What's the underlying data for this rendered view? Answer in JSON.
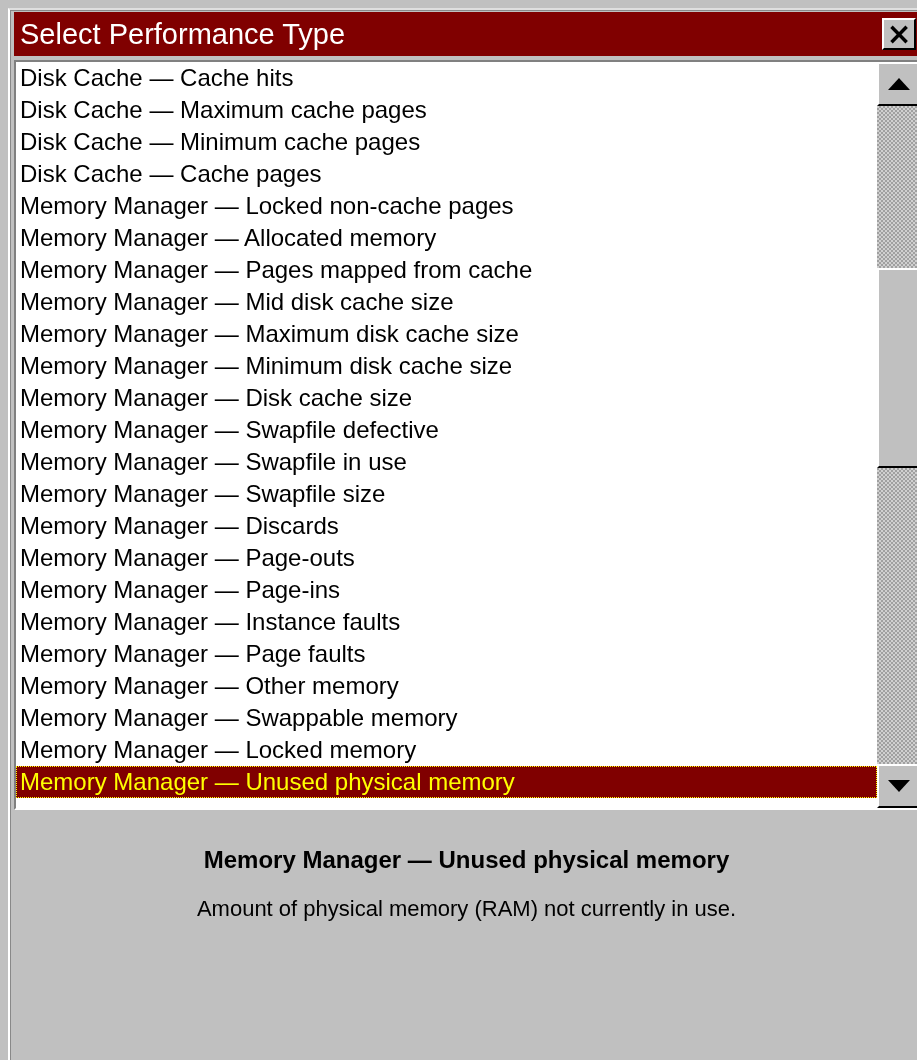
{
  "window": {
    "title": "Select Performance Type",
    "close": "×"
  },
  "list": {
    "items": [
      {
        "label": "Disk Cache — Cache hits",
        "selected": false
      },
      {
        "label": "Disk Cache — Maximum cache pages",
        "selected": false
      },
      {
        "label": "Disk Cache — Minimum cache pages",
        "selected": false
      },
      {
        "label": "Disk Cache — Cache pages",
        "selected": false
      },
      {
        "label": "Memory Manager — Locked non-cache pages",
        "selected": false
      },
      {
        "label": "Memory Manager — Allocated memory",
        "selected": false
      },
      {
        "label": "Memory Manager — Pages mapped from cache",
        "selected": false
      },
      {
        "label": "Memory Manager — Mid disk cache size",
        "selected": false
      },
      {
        "label": "Memory Manager — Maximum disk cache size",
        "selected": false
      },
      {
        "label": "Memory Manager — Minimum disk cache size",
        "selected": false
      },
      {
        "label": "Memory Manager — Disk cache size",
        "selected": false
      },
      {
        "label": "Memory Manager — Swapfile defective",
        "selected": false
      },
      {
        "label": "Memory Manager — Swapfile in use",
        "selected": false
      },
      {
        "label": "Memory Manager — Swapfile size",
        "selected": false
      },
      {
        "label": "Memory Manager — Discards",
        "selected": false
      },
      {
        "label": "Memory Manager — Page-outs",
        "selected": false
      },
      {
        "label": "Memory Manager — Page-ins",
        "selected": false
      },
      {
        "label": "Memory Manager — Instance faults",
        "selected": false
      },
      {
        "label": "Memory Manager — Page faults",
        "selected": false
      },
      {
        "label": "Memory Manager — Other memory",
        "selected": false
      },
      {
        "label": "Memory Manager — Swappable memory",
        "selected": false
      },
      {
        "label": "Memory Manager — Locked memory",
        "selected": false
      },
      {
        "label": "Memory Manager — Unused physical memory",
        "selected": true
      }
    ]
  },
  "details": {
    "title": "Memory Manager — Unused physical memory",
    "description": "Amount of physical memory (RAM) not currently in use."
  }
}
